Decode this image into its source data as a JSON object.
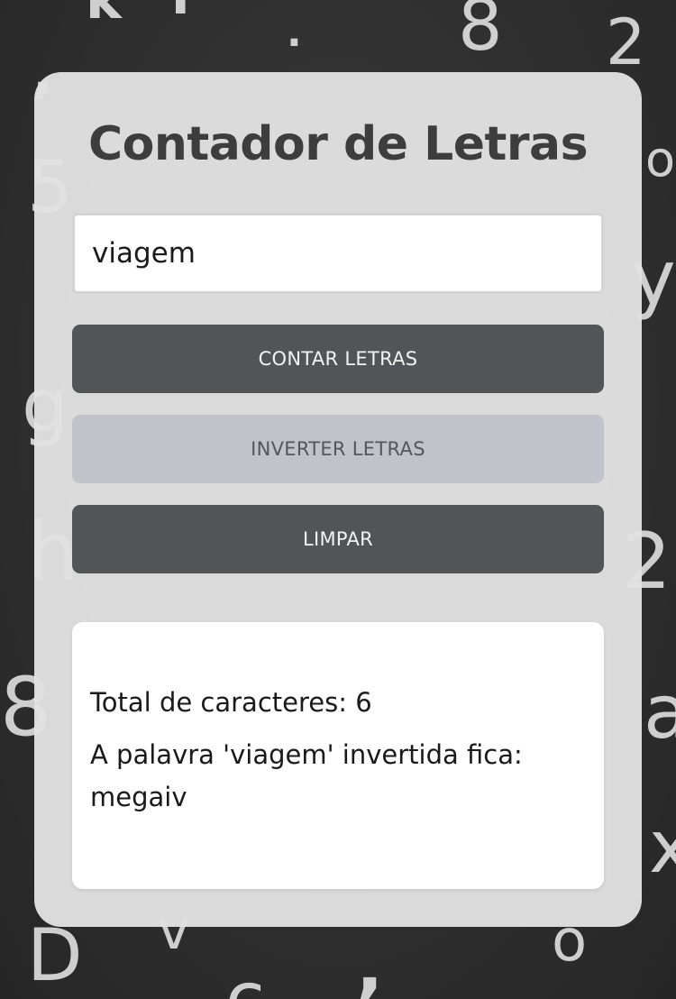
{
  "background": {
    "letters": [
      "k",
      "r",
      ".",
      "8",
      "2",
      ",",
      "5",
      "o",
      "y",
      "g",
      "h",
      "2",
      "8",
      "a",
      "x",
      "D",
      "v",
      "o",
      ",",
      "c"
    ]
  },
  "card": {
    "title": "Contador de Letras",
    "input": {
      "value": "viagem"
    },
    "buttons": {
      "count_label": "CONTAR LETRAS",
      "reverse_label": "INVERTER LETRAS",
      "clear_label": "LIMPAR"
    },
    "result": {
      "total_line": "Total de caracteres: 6",
      "reverse_line": "A palavra 'viagem' invertida fica: megaiv"
    }
  },
  "colors": {
    "card_bg": "#e2e2e2",
    "title": "#3d3d3d",
    "button_dark": "#525458",
    "button_light": "#c0c3c9"
  }
}
